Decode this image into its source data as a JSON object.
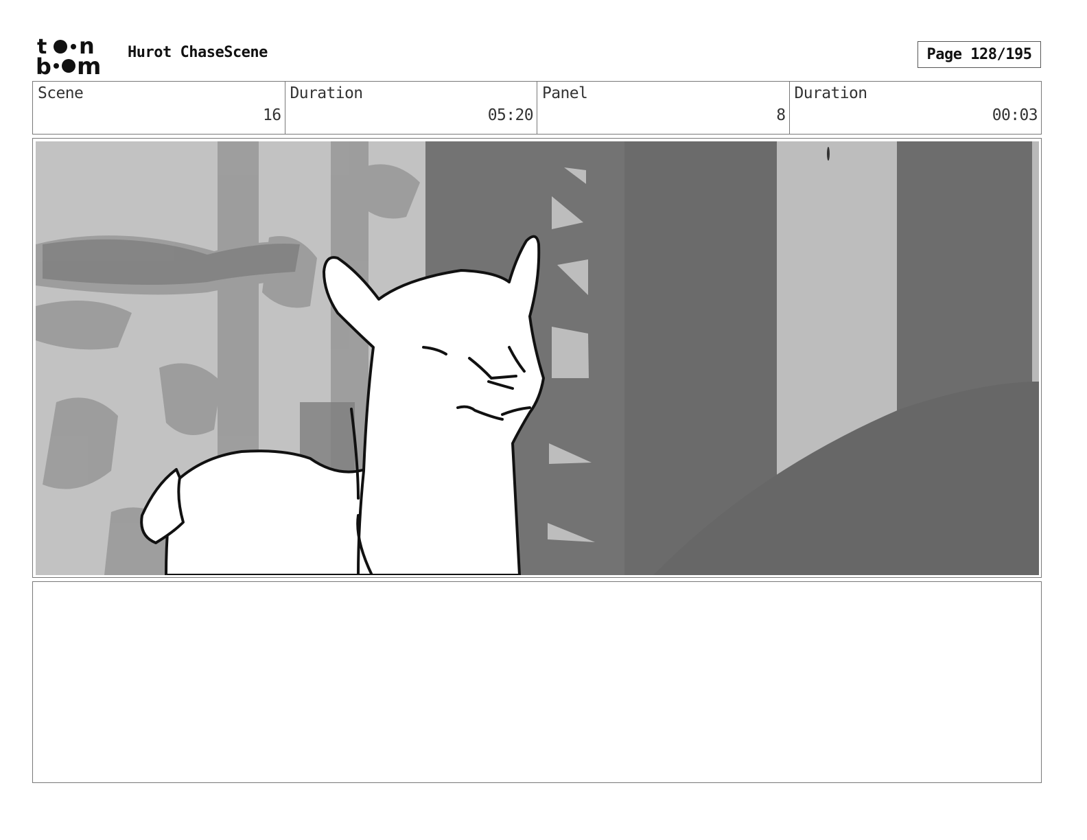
{
  "header": {
    "logo_text": "toon boom",
    "project_title": "Hurot ChaseScene",
    "page_label": "Page 128/195"
  },
  "info": {
    "scene_label": "Scene",
    "scene_value": "16",
    "scene_duration_label": "Duration",
    "scene_duration_value": "05:20",
    "panel_label": "Panel",
    "panel_value": "8",
    "panel_duration_label": "Duration",
    "panel_duration_value": "00:03"
  },
  "panel": {
    "colors": {
      "bg_light": "#c4c4c4",
      "bg_mid": "#8a8a8a",
      "bg_dark": "#707070",
      "line": "#111111",
      "fill": "#ffffff"
    }
  },
  "notes": {
    "text": ""
  }
}
